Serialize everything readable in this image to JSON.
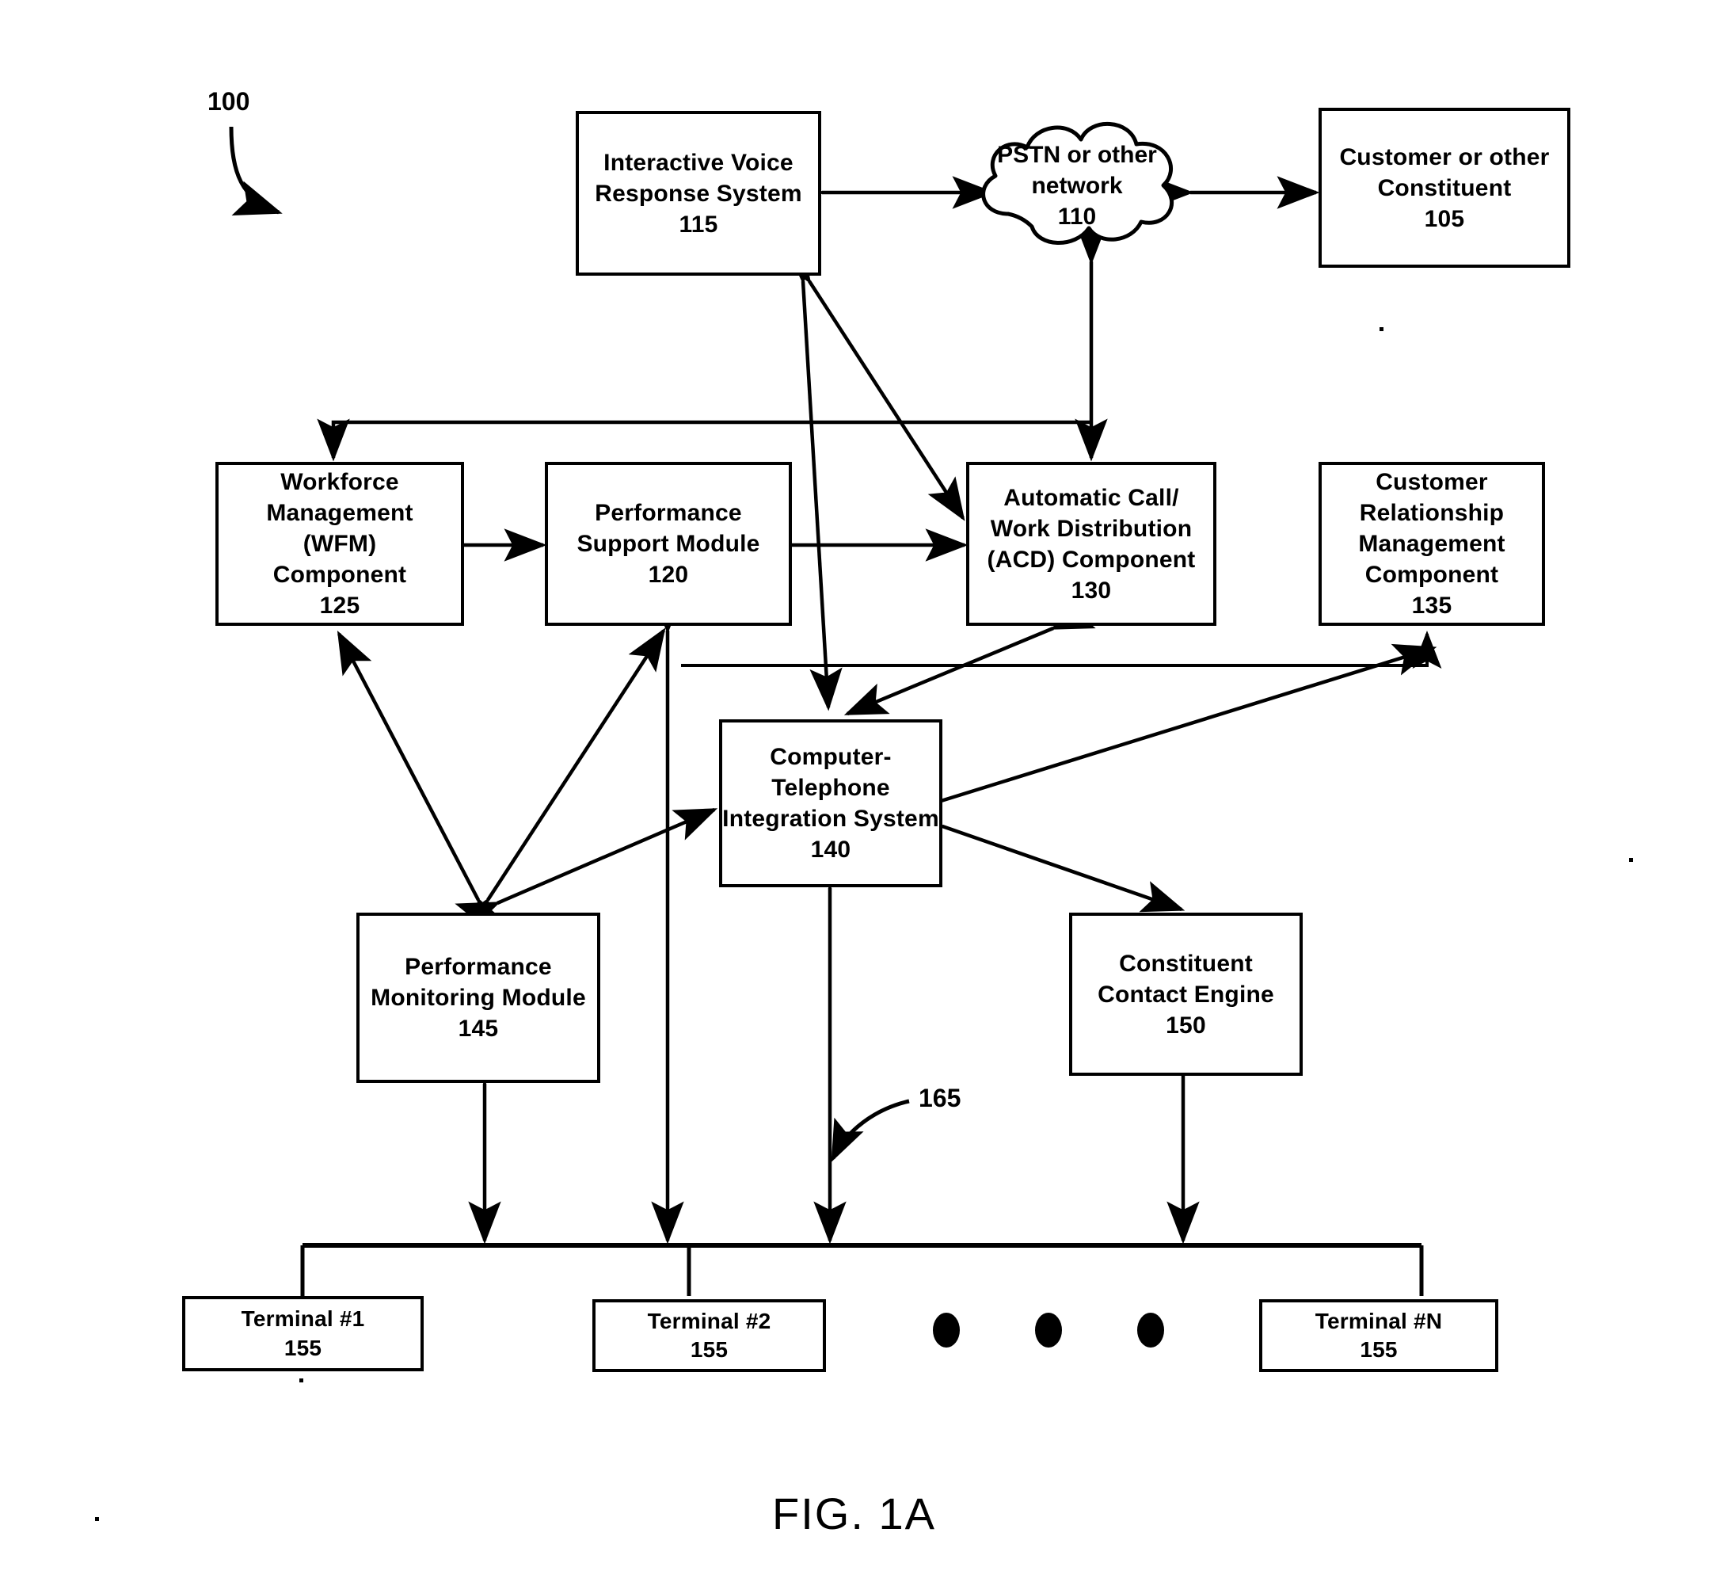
{
  "figure": {
    "label": "FIG. 1A",
    "system_ref": "100",
    "network_ref": "165"
  },
  "nodes": {
    "ivr": {
      "label": "Interactive Voice\nResponse System\n115",
      "ref": "115"
    },
    "pstn": {
      "label": "PSTN or other\nnetwork\n110",
      "ref": "110"
    },
    "customer": {
      "label": "Customer or other\nConstituent\n105",
      "ref": "105"
    },
    "wfm": {
      "label": "Workforce\nManagement\n(WFM)\nComponent\n125",
      "ref": "125"
    },
    "psm": {
      "label": "Performance\nSupport Module\n120",
      "ref": "120"
    },
    "acd": {
      "label": "Automatic Call/\nWork Distribution\n(ACD) Component\n130",
      "ref": "130"
    },
    "crm": {
      "label": "Customer\nRelationship\nManagement\nComponent\n135",
      "ref": "135"
    },
    "cti": {
      "label": "Computer-\nTelephone\nIntegration System\n140",
      "ref": "140"
    },
    "pmm": {
      "label": "Performance\nMonitoring Module\n145",
      "ref": "145"
    },
    "cce": {
      "label": "Constituent\nContact Engine\n150",
      "ref": "150"
    },
    "term1": {
      "label": "Terminal #1\n155",
      "ref": "155"
    },
    "term2": {
      "label": "Terminal #2\n155",
      "ref": "155"
    },
    "termn": {
      "label": "Terminal #N\n155",
      "ref": "155"
    }
  },
  "ellipsis": {
    "count": 3,
    "meaning": "additional terminals"
  },
  "connections": [
    {
      "from": "ivr",
      "to": "pstn",
      "kind": "bidirectional"
    },
    {
      "from": "pstn",
      "to": "customer",
      "kind": "bidirectional"
    },
    {
      "from": "pstn",
      "to": "acd",
      "kind": "bidirectional"
    },
    {
      "from": "wfm",
      "to": "psm",
      "kind": "bidirectional"
    },
    {
      "from": "psm",
      "to": "acd",
      "kind": "bidirectional"
    },
    {
      "from": "acd",
      "to": "wfm",
      "kind": "directed"
    },
    {
      "from": "ivr",
      "to": "acd",
      "kind": "bidirectional"
    },
    {
      "from": "ivr",
      "to": "cti",
      "kind": "bidirectional"
    },
    {
      "from": "acd",
      "to": "cti",
      "kind": "bidirectional"
    },
    {
      "from": "cti",
      "to": "crm",
      "kind": "bidirectional"
    },
    {
      "from": "pmm",
      "to": "wfm",
      "kind": "bidirectional"
    },
    {
      "from": "pmm",
      "to": "psm",
      "kind": "bidirectional"
    },
    {
      "from": "pmm",
      "to": "cti",
      "kind": "bidirectional"
    },
    {
      "from": "cti",
      "to": "cce",
      "kind": "bidirectional"
    },
    {
      "from": "pmm",
      "to": "bus",
      "kind": "bidirectional"
    },
    {
      "from": "psm",
      "to": "bus",
      "kind": "bidirectional"
    },
    {
      "from": "cti",
      "to": "bus",
      "kind": "bidirectional"
    },
    {
      "from": "cce",
      "to": "bus",
      "kind": "bidirectional"
    },
    {
      "from": "bus",
      "to": "term1",
      "kind": "line"
    },
    {
      "from": "bus",
      "to": "term2",
      "kind": "line"
    },
    {
      "from": "bus",
      "to": "termn",
      "kind": "line"
    }
  ],
  "colors": {
    "ink": "#000000",
    "paper": "#ffffff"
  }
}
